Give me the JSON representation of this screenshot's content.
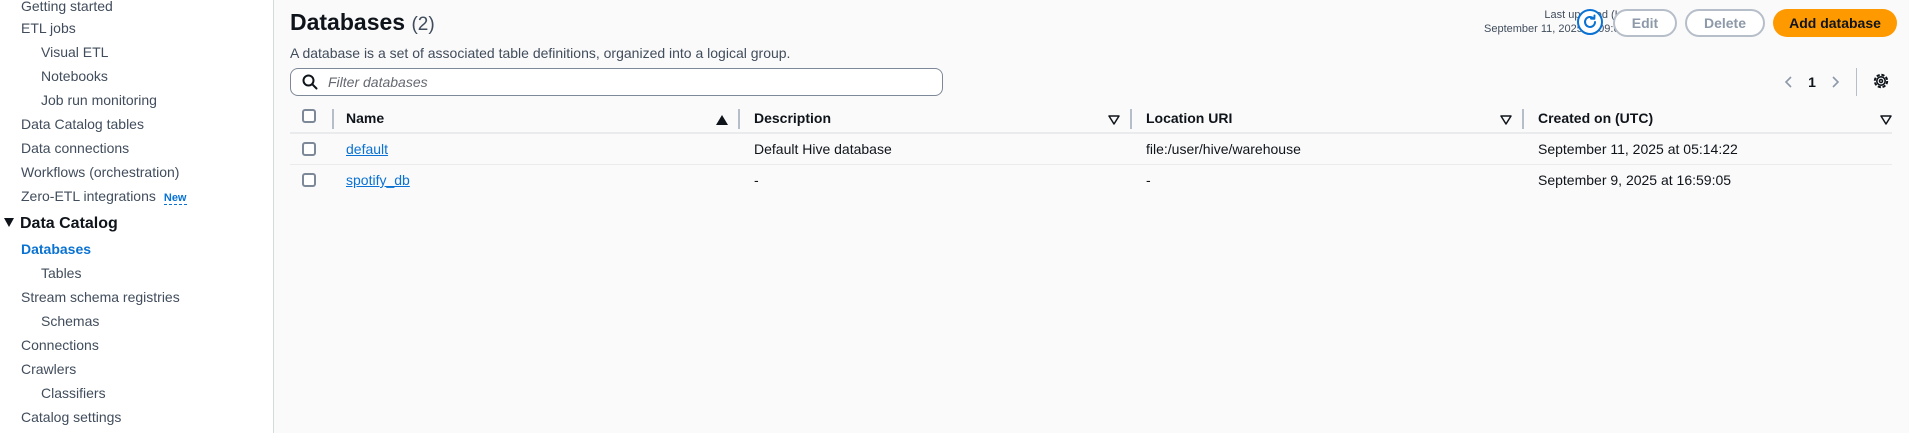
{
  "sidebar": {
    "items": [
      {
        "label": "Getting started",
        "level": 1
      },
      {
        "label": "ETL jobs",
        "level": 1
      },
      {
        "label": "Visual ETL",
        "level": 2
      },
      {
        "label": "Notebooks",
        "level": 2
      },
      {
        "label": "Job run monitoring",
        "level": 2
      },
      {
        "label": "Data Catalog tables",
        "level": 1
      },
      {
        "label": "Data connections",
        "level": 1
      },
      {
        "label": "Workflows (orchestration)",
        "level": 1
      },
      {
        "label": "Zero-ETL integrations",
        "level": 1,
        "badge": "New"
      }
    ],
    "section": {
      "label": "Data Catalog"
    },
    "catalog_items": [
      {
        "label": "Databases",
        "level": 1,
        "active": true
      },
      {
        "label": "Tables",
        "level": 2
      },
      {
        "label": "Stream schema registries",
        "level": 1
      },
      {
        "label": "Schemas",
        "level": 2
      },
      {
        "label": "Connections",
        "level": 1
      },
      {
        "label": "Crawlers",
        "level": 1
      },
      {
        "label": "Classifiers",
        "level": 2
      },
      {
        "label": "Catalog settings",
        "level": 1
      }
    ]
  },
  "header": {
    "title": "Databases",
    "count": "(2)",
    "description": "A database is a set of associated table definitions, organized into a logical group.",
    "last_updated_label": "Last updated (UTC)",
    "last_updated_value": "September 11, 2025 at 09:01:03",
    "edit_label": "Edit",
    "delete_label": "Delete",
    "add_label": "Add database"
  },
  "search": {
    "placeholder": "Filter databases",
    "value": ""
  },
  "pagination": {
    "current_page": "1"
  },
  "table": {
    "columns": [
      "Name",
      "Description",
      "Location URI",
      "Created on (UTC)"
    ],
    "rows": [
      {
        "name": "default",
        "description": "Default Hive database",
        "location": "file:/user/hive/warehouse",
        "created": "September 11, 2025 at 05:14:22"
      },
      {
        "name": "spotify_db",
        "description": "-",
        "location": "-",
        "created": "September 9, 2025 at 16:59:05"
      }
    ]
  },
  "colors": {
    "accent": "#0972d3",
    "primary_button": "#ff9900",
    "text": "#0f141a"
  }
}
